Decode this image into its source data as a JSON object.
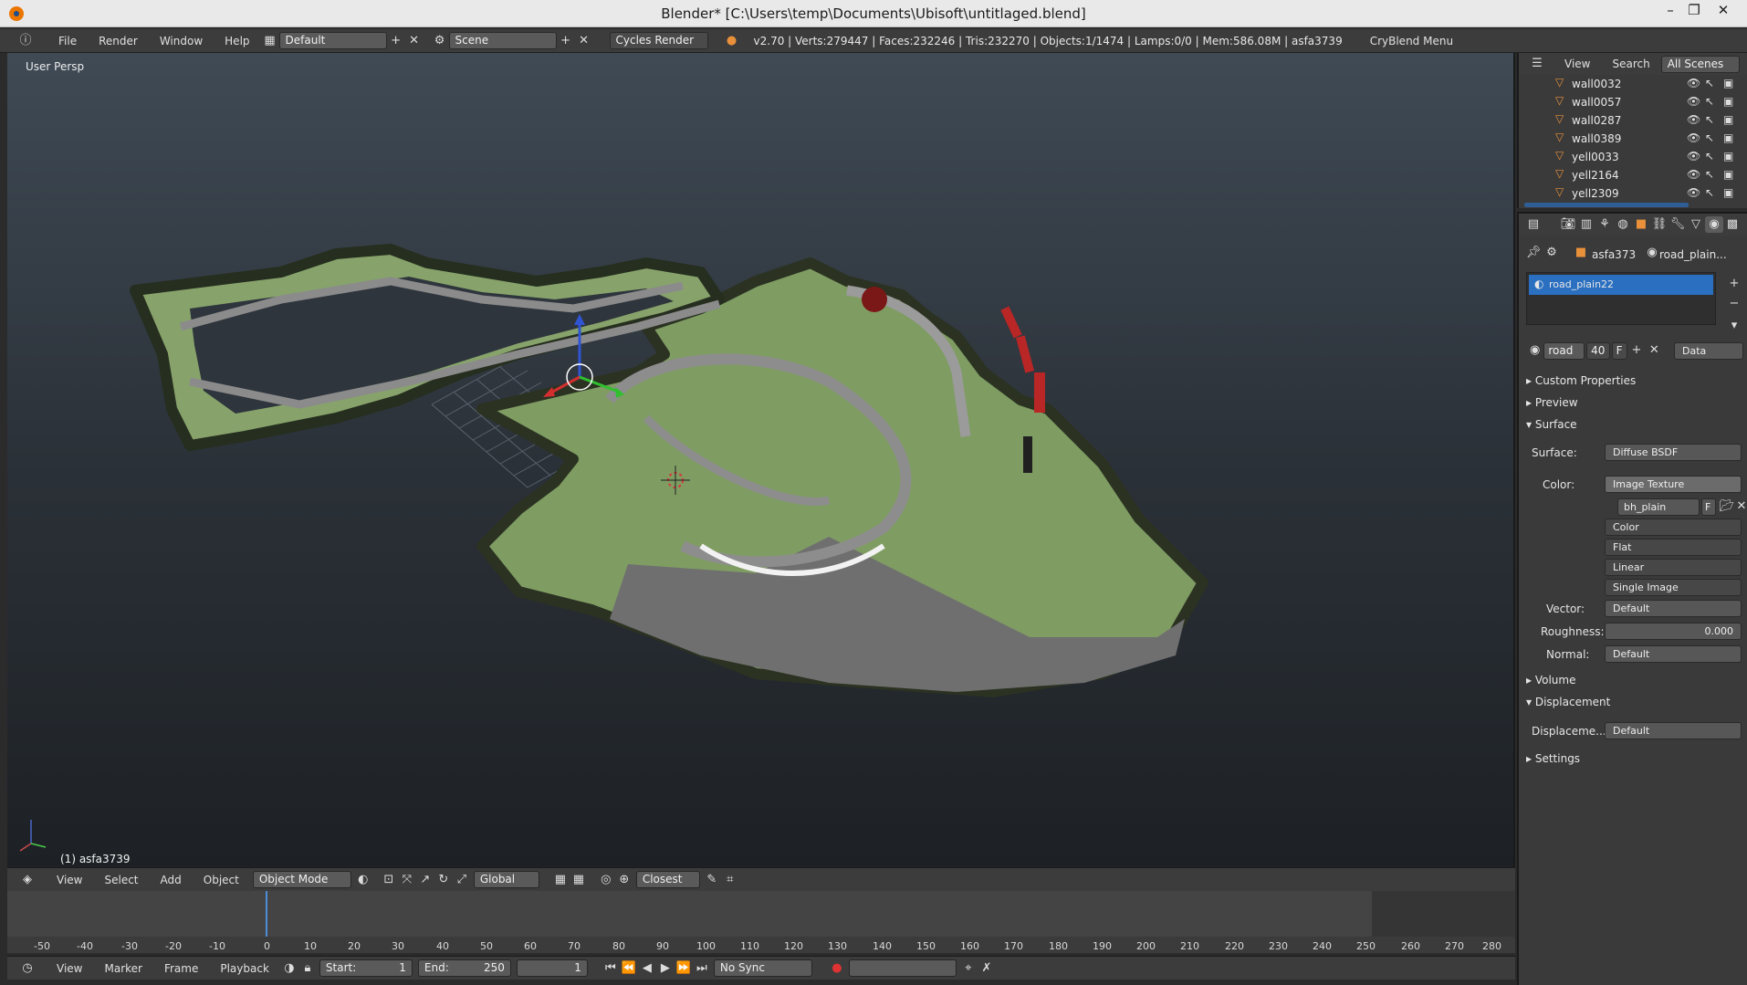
{
  "window": {
    "title": "Blender* [C:\\Users\\temp\\Documents\\Ubisoft\\untitlaged.blend]",
    "minimize": "–",
    "maximize": "❐",
    "close": "✕"
  },
  "info_header": {
    "menus": [
      "File",
      "Render",
      "Window",
      "Help"
    ],
    "layout": "Default",
    "scene": "Scene",
    "engine": "Cycles Render",
    "stats": "v2.70 | Verts:279447 | Faces:232246 | Tris:232270 | Objects:1/1474 | Lamps:0/0 | Mem:586.08M | asfa3739",
    "extra_menu": "CryBlend Menu"
  },
  "viewport": {
    "label": "User Persp",
    "object_label": "(1) asfa3739"
  },
  "view3d_header": {
    "menus": [
      "View",
      "Select",
      "Add",
      "Object"
    ],
    "mode": "Object Mode",
    "orientation": "Global",
    "snap": "Closest"
  },
  "timeline": {
    "ticks": [
      "-50",
      "-40",
      "-30",
      "-20",
      "-10",
      "0",
      "10",
      "20",
      "30",
      "40",
      "50",
      "60",
      "70",
      "80",
      "90",
      "100",
      "110",
      "120",
      "130",
      "140",
      "150",
      "160",
      "170",
      "180",
      "190",
      "200",
      "210",
      "220",
      "230",
      "240",
      "250",
      "260",
      "270",
      "280"
    ],
    "menus": [
      "View",
      "Marker",
      "Frame",
      "Playback"
    ],
    "start_label": "Start:",
    "start_value": "1",
    "end_label": "End:",
    "end_value": "250",
    "current_frame": "1",
    "sync": "No Sync"
  },
  "outliner": {
    "tabs": [
      "View",
      "Search",
      "All Scenes"
    ],
    "items": [
      "wall0032",
      "wall0057",
      "wall0287",
      "wall0389",
      "yell0033",
      "yell2164",
      "yell2309"
    ]
  },
  "properties": {
    "breadcrumb_object": "asfa373",
    "breadcrumb_material": "road_plain...",
    "material_slot": "road_plain22",
    "material_name": "road",
    "users": "40",
    "fake_user": "F",
    "link": "Data",
    "panels": {
      "custom_properties": "Custom Properties",
      "preview": "Preview",
      "surface": "Surface",
      "volume": "Volume",
      "displacement": "Displacement",
      "settings": "Settings"
    },
    "surface_label": "Surface:",
    "surface_value": "Diffuse BSDF",
    "color_label": "Color:",
    "color_value": "Image Texture",
    "image_name": "bh_plain",
    "image_f": "F",
    "color_space": "Color",
    "projection": "Flat",
    "interpolation": "Linear",
    "source": "Single Image",
    "vector_label": "Vector:",
    "vector_value": "Default",
    "roughness_label": "Roughness:",
    "roughness_value": "0.000",
    "normal_label": "Normal:",
    "normal_value": "Default",
    "displacement_label": "Displaceme...",
    "displacement_value": "Default"
  }
}
